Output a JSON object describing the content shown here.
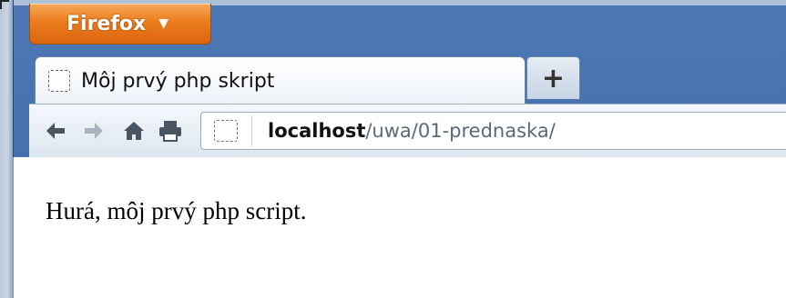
{
  "app_menu": {
    "label": "Firefox",
    "caret": "▼"
  },
  "tabs": [
    {
      "title": "Môj prvý php skript",
      "favicon": "blank-page-icon",
      "active": true
    }
  ],
  "new_tab": {
    "label": "+"
  },
  "toolbar": {
    "back_icon": "arrow-left-icon",
    "forward_icon": "arrow-right-icon",
    "home_icon": "home-icon",
    "print_icon": "printer-icon"
  },
  "address_bar": {
    "host": "localhost",
    "path": "/uwa/01-prednaska/",
    "site_icon": "blank-page-icon"
  },
  "page": {
    "text": "Hurá, môj prvý php script."
  },
  "colors": {
    "app_button": "#ec7d1e",
    "frame": "#4d78b5",
    "toolbar": "#e8eef5",
    "content_bg": "#ffffff"
  }
}
